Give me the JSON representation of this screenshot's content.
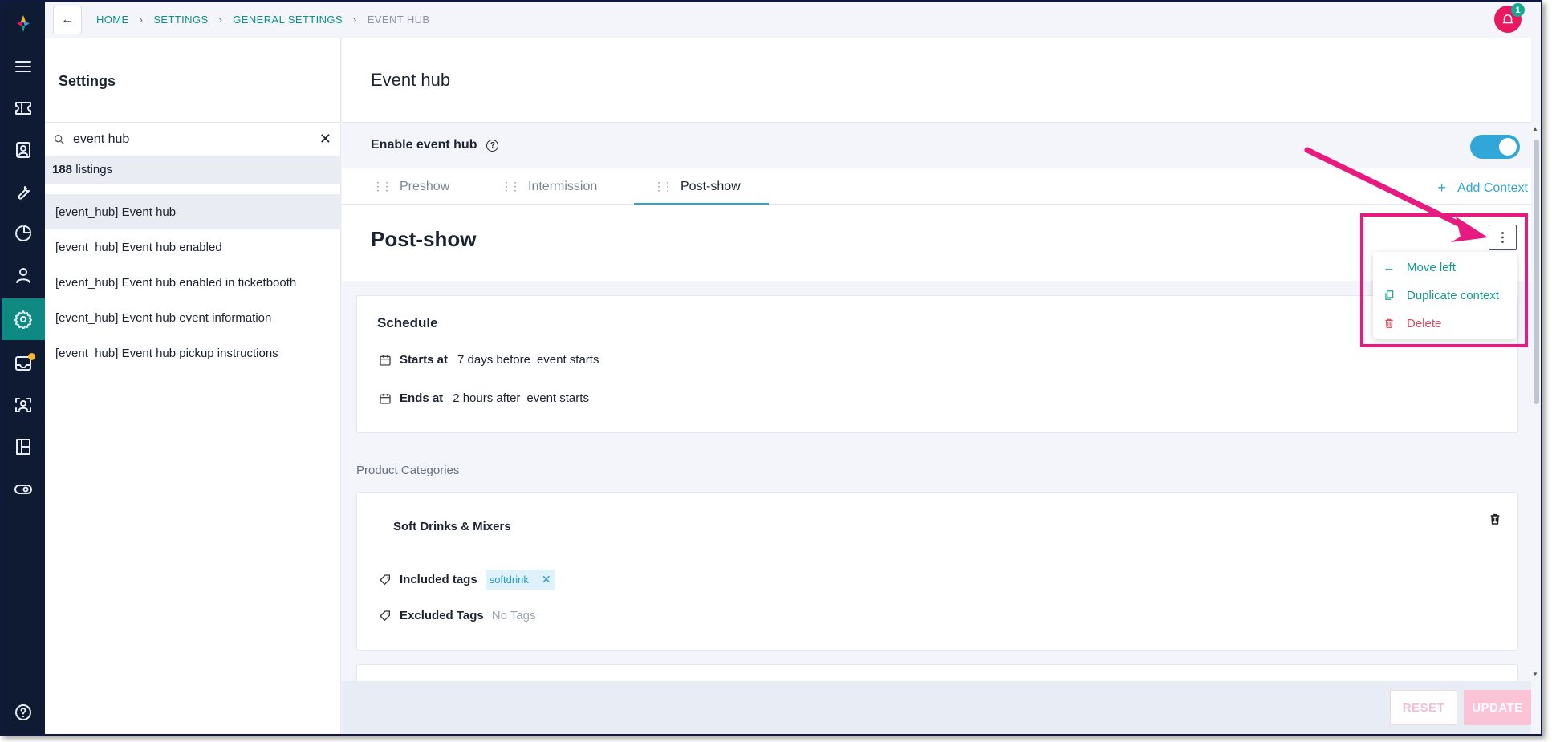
{
  "breadcrumb": [
    "HOME",
    "SETTINGS",
    "GENERAL SETTINGS",
    "EVENT HUB"
  ],
  "notifications": {
    "count": "1"
  },
  "sidebar_icons": [
    "menu-icon",
    "ticket-icon",
    "contact-card-icon",
    "wrench-icon",
    "pie-chart-icon",
    "user-icon",
    "settings-icon",
    "inbox-icon",
    "scan-user-icon",
    "board-icon",
    "toggle-icon",
    "help-icon"
  ],
  "settings_panel": {
    "title": "Settings",
    "search_value": "event hub",
    "count_number": "188",
    "count_label": " listings",
    "items": [
      "[event_hub] Event hub",
      "[event_hub] Event hub enabled",
      "[event_hub] Event hub enabled in ticketbooth",
      "[event_hub] Event hub event information",
      "[event_hub] Event hub pickup instructions"
    ]
  },
  "main": {
    "title": "Event hub",
    "enable_label": "Enable event hub",
    "enable_state": true,
    "tabs": [
      "Preshow",
      "Intermission",
      "Post-show"
    ],
    "active_tab": "Post-show",
    "add_context": "Add Context",
    "context_title": "Post-show",
    "schedule": {
      "heading": "Schedule",
      "starts_label": "Starts at",
      "starts_value": "7 days before",
      "starts_ref": "event starts",
      "ends_label": "Ends at",
      "ends_value": "2 hours after",
      "ends_ref": "event starts"
    },
    "product_categories_label": "Product Categories",
    "category": {
      "name": "Soft Drinks & Mixers",
      "included_label": "Included tags",
      "included_tags": [
        "softdrink"
      ],
      "excluded_label": "Excluded Tags",
      "excluded_value": "No Tags"
    },
    "context_menu": {
      "move_left": "Move left",
      "duplicate": "Duplicate context",
      "delete": "Delete"
    },
    "footer": {
      "reset": "RESET",
      "update": "UPDATE"
    }
  },
  "colors": {
    "accent": "#0f8f85",
    "brand_blue": "#2ea5d6",
    "danger": "#e4455e",
    "annotation": "#e8197f",
    "rail_bg": "#0e1b33"
  }
}
